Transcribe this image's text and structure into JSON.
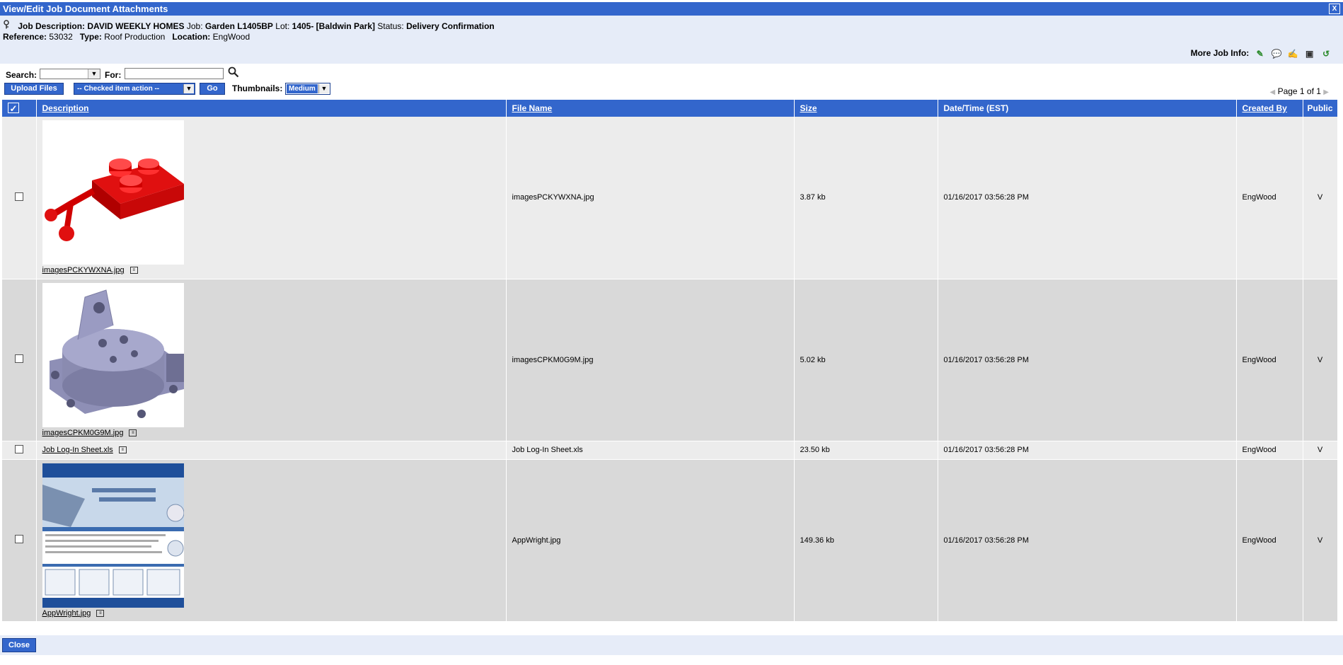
{
  "window": {
    "title": "View/Edit Job Document Attachments",
    "close_label": "X"
  },
  "job": {
    "desc_label": "Job Description:",
    "builder": "DAVID WEEKLY HOMES",
    "job_label": "Job:",
    "job_value": "Garden L1405BP",
    "lot_label": "Lot:",
    "lot_value": "1405- [Baldwin Park]",
    "status_label": "Status:",
    "status_value": "Delivery Confirmation",
    "reference_label": "Reference:",
    "reference_value": "53032",
    "type_label": "Type:",
    "type_value": "Roof Production",
    "location_label": "Location:",
    "location_value": "EngWood",
    "more_info_label": "More Job Info:"
  },
  "toolbar": {
    "search_label": "Search:",
    "for_label": "For:",
    "upload_label": "Upload Files",
    "action_label": "-- Checked item action --",
    "go_label": "Go",
    "thumbnails_label": "Thumbnails:",
    "thumbnails_value": "Medium",
    "page_label": "Page 1 of 1"
  },
  "table": {
    "columns": {
      "description": "Description",
      "file_name": "File Name",
      "size": "Size",
      "datetime": "Date/Time (EST)",
      "created_by": "Created By",
      "public": "Public"
    },
    "rows": [
      {
        "caption": "imagesPCKYWXNA.jpg",
        "file_name": "imagesPCKYWXNA.jpg",
        "size": "3.87 kb",
        "datetime": "01/16/2017 03:56:28 PM",
        "created_by": "EngWood",
        "public": "V"
      },
      {
        "caption": "imagesCPKM0G9M.jpg",
        "file_name": "imagesCPKM0G9M.jpg",
        "size": "5.02 kb",
        "datetime": "01/16/2017 03:56:28 PM",
        "created_by": "EngWood",
        "public": "V"
      },
      {
        "caption": "Job Log-In Sheet.xls",
        "file_name": "Job Log-In Sheet.xls",
        "size": "23.50 kb",
        "datetime": "01/16/2017 03:56:28 PM",
        "created_by": "EngWood",
        "public": "V"
      },
      {
        "caption": "AppWright.jpg",
        "file_name": "AppWright.jpg",
        "size": "149.36 kb",
        "datetime": "01/16/2017 03:56:28 PM",
        "created_by": "EngWood",
        "public": "V"
      }
    ]
  },
  "footer": {
    "close_label": "Close"
  },
  "colors": {
    "accent": "#3366cc",
    "panel": "#e6ecf8",
    "row_light": "#ececec",
    "row_dark": "#d9d9d9"
  }
}
